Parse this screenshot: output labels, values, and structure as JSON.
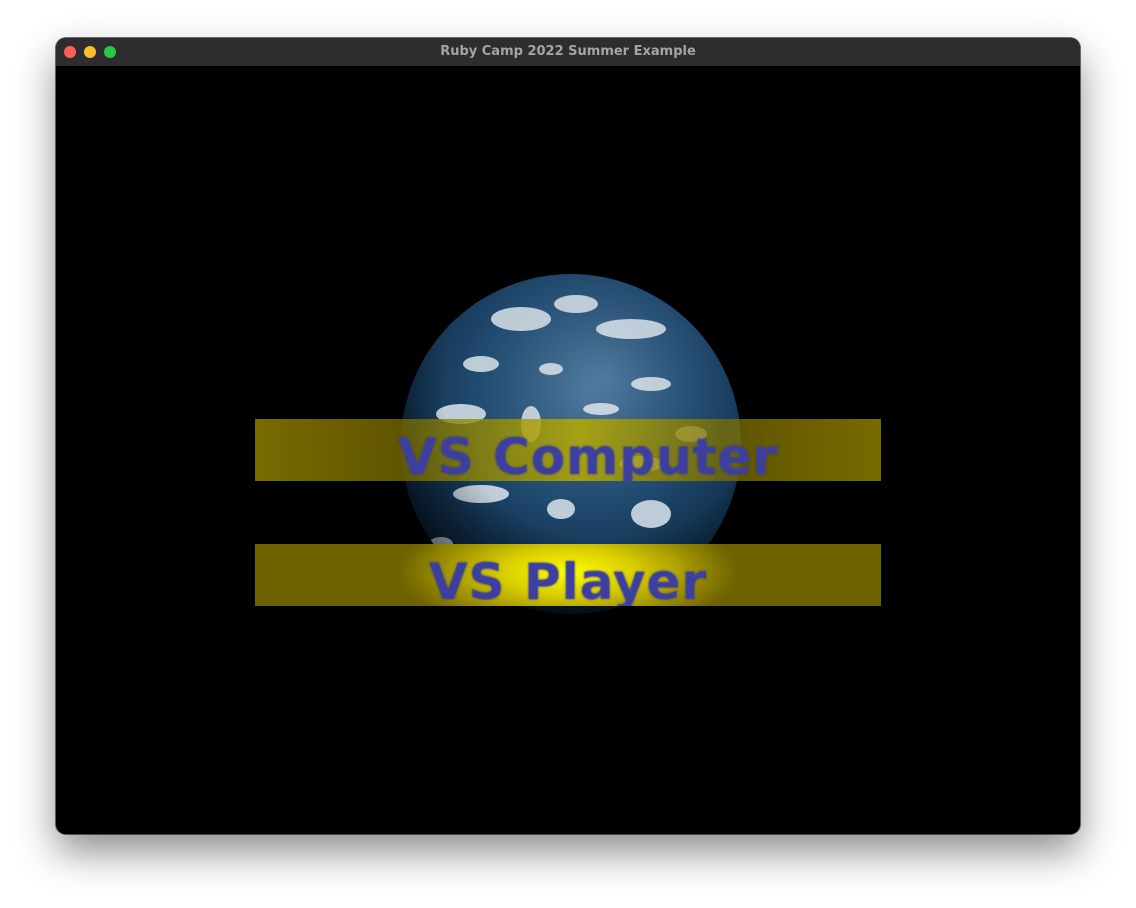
{
  "window": {
    "title": "Ruby Camp 2022 Summer Example"
  },
  "scene": {
    "globe_icon": "earth-globe",
    "menu": [
      {
        "label": "VS Computer",
        "highlighted": false
      },
      {
        "label": "VS Player",
        "highlighted": true
      }
    ]
  },
  "colors": {
    "button_gold": "#7e7000",
    "highlight_yellow": "#ffff00",
    "label_blue": "#3d3fa0",
    "background": "#000000"
  }
}
